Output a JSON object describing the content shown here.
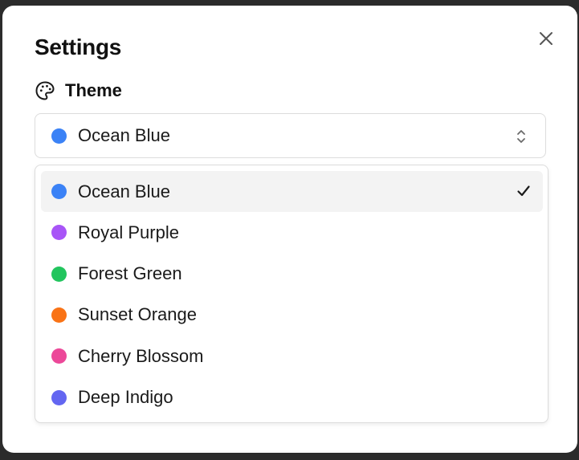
{
  "dialog": {
    "title": "Settings",
    "close_icon": "close-icon"
  },
  "theme_section": {
    "label": "Theme",
    "icon": "palette-icon"
  },
  "select": {
    "value": "Ocean Blue",
    "color": "#3b82f6",
    "icon": "chevron-up-down-icon"
  },
  "options": [
    {
      "label": "Ocean Blue",
      "color": "#3b82f6",
      "selected": true
    },
    {
      "label": "Royal Purple",
      "color": "#a855f7",
      "selected": false
    },
    {
      "label": "Forest Green",
      "color": "#22c55e",
      "selected": false
    },
    {
      "label": "Sunset Orange",
      "color": "#f97316",
      "selected": false
    },
    {
      "label": "Cherry Blossom",
      "color": "#ec4899",
      "selected": false
    },
    {
      "label": "Deep Indigo",
      "color": "#6366f1",
      "selected": false
    }
  ],
  "check_icon": "check-icon"
}
